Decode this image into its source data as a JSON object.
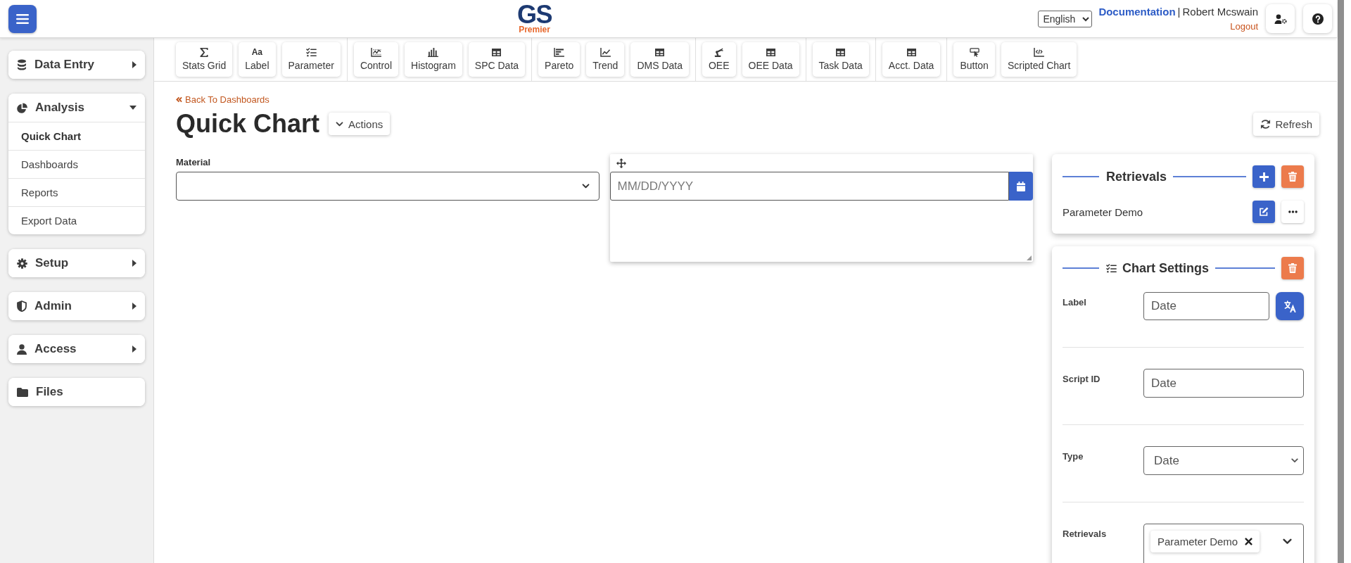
{
  "header": {
    "logo": {
      "title": "GS",
      "subtitle": "Premier"
    },
    "language": {
      "value": "English"
    },
    "documentation_link": "Documentation",
    "separator": "|",
    "user_name": "Robert Mcswain",
    "logout_link": "Logout"
  },
  "sidebar": {
    "sections": [
      {
        "kind": "group",
        "label": "Data Entry",
        "expanded": false
      },
      {
        "kind": "group",
        "label": "Analysis",
        "expanded": true,
        "items": [
          {
            "label": "Quick Chart",
            "selected": true
          },
          {
            "label": "Dashboards",
            "selected": false
          },
          {
            "label": "Reports",
            "selected": false
          },
          {
            "label": "Export Data",
            "selected": false
          }
        ]
      },
      {
        "kind": "group",
        "label": "Setup",
        "expanded": false
      },
      {
        "kind": "group",
        "label": "Admin",
        "expanded": false
      },
      {
        "kind": "group",
        "label": "Access",
        "expanded": false
      },
      {
        "kind": "link",
        "label": "Files"
      }
    ]
  },
  "toolbar": {
    "groups": [
      {
        "buttons": [
          {
            "label": "Stats Grid"
          },
          {
            "label": "Label",
            "glyph": "Aa"
          },
          {
            "label": "Parameter"
          }
        ]
      },
      {
        "buttons": [
          {
            "label": "Control"
          },
          {
            "label": "Histogram"
          },
          {
            "label": "SPC Data"
          }
        ]
      },
      {
        "buttons": [
          {
            "label": "Pareto"
          },
          {
            "label": "Trend"
          },
          {
            "label": "DMS Data"
          }
        ]
      },
      {
        "buttons": [
          {
            "label": "OEE"
          },
          {
            "label": "OEE Data"
          }
        ]
      },
      {
        "buttons": [
          {
            "label": "Task Data"
          }
        ]
      },
      {
        "buttons": [
          {
            "label": "Acct. Data"
          }
        ]
      },
      {
        "buttons": [
          {
            "label": "Button"
          },
          {
            "label": "Scripted Chart"
          }
        ]
      }
    ]
  },
  "page": {
    "back_link": "Back To Dashboards",
    "title": "Quick Chart",
    "actions_button": "Actions",
    "refresh_button": "Refresh"
  },
  "material": {
    "label": "Material"
  },
  "date_widget": {
    "placeholder": "MM/DD/YYYY"
  },
  "retrievals_panel": {
    "title": "Retrievals",
    "items": [
      {
        "name": "Parameter Demo"
      }
    ]
  },
  "chart_settings": {
    "title": "Chart Settings",
    "fields": [
      {
        "kind": "translatable",
        "label": "Label",
        "value": "Date"
      },
      {
        "kind": "text",
        "label": "Script ID",
        "value": "Date"
      },
      {
        "kind": "select",
        "label": "Type",
        "value": "Date"
      },
      {
        "kind": "multiselect",
        "label": "Retrievals",
        "chips": [
          {
            "label": "Parameter Demo"
          }
        ]
      }
    ]
  }
}
